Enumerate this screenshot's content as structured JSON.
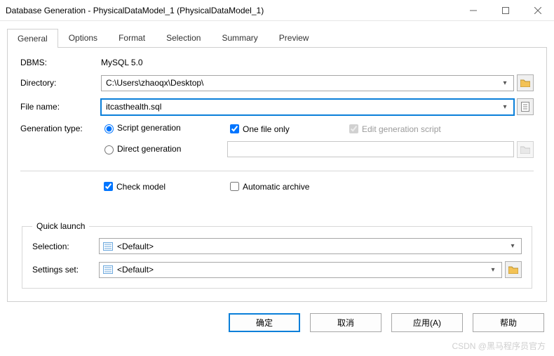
{
  "window": {
    "title": "Database Generation - PhysicalDataModel_1 (PhysicalDataModel_1)"
  },
  "tabs": [
    "General",
    "Options",
    "Format",
    "Selection",
    "Summary",
    "Preview"
  ],
  "labels": {
    "dbms": "DBMS:",
    "directory": "Directory:",
    "filename": "File name:",
    "gentype": "Generation type:",
    "selection": "Selection:",
    "settings": "Settings set:"
  },
  "values": {
    "dbms": "MySQL 5.0",
    "directory": "C:\\Users\\zhaoqx\\Desktop\\",
    "filename": "itcasthealth.sql",
    "selection": "<Default>",
    "settings": "<Default>"
  },
  "gentype": {
    "script": "Script generation",
    "direct": "Direct generation",
    "onefile": "One file only",
    "editscript": "Edit generation script"
  },
  "opts": {
    "checkmodel": "Check model",
    "autoarchive": "Automatic archive"
  },
  "groups": {
    "quicklaunch": "Quick launch"
  },
  "buttons": {
    "ok": "确定",
    "cancel": "取消",
    "apply": "应用(A)",
    "help": "帮助"
  },
  "watermark": "CSDN @黑马程序员官方"
}
